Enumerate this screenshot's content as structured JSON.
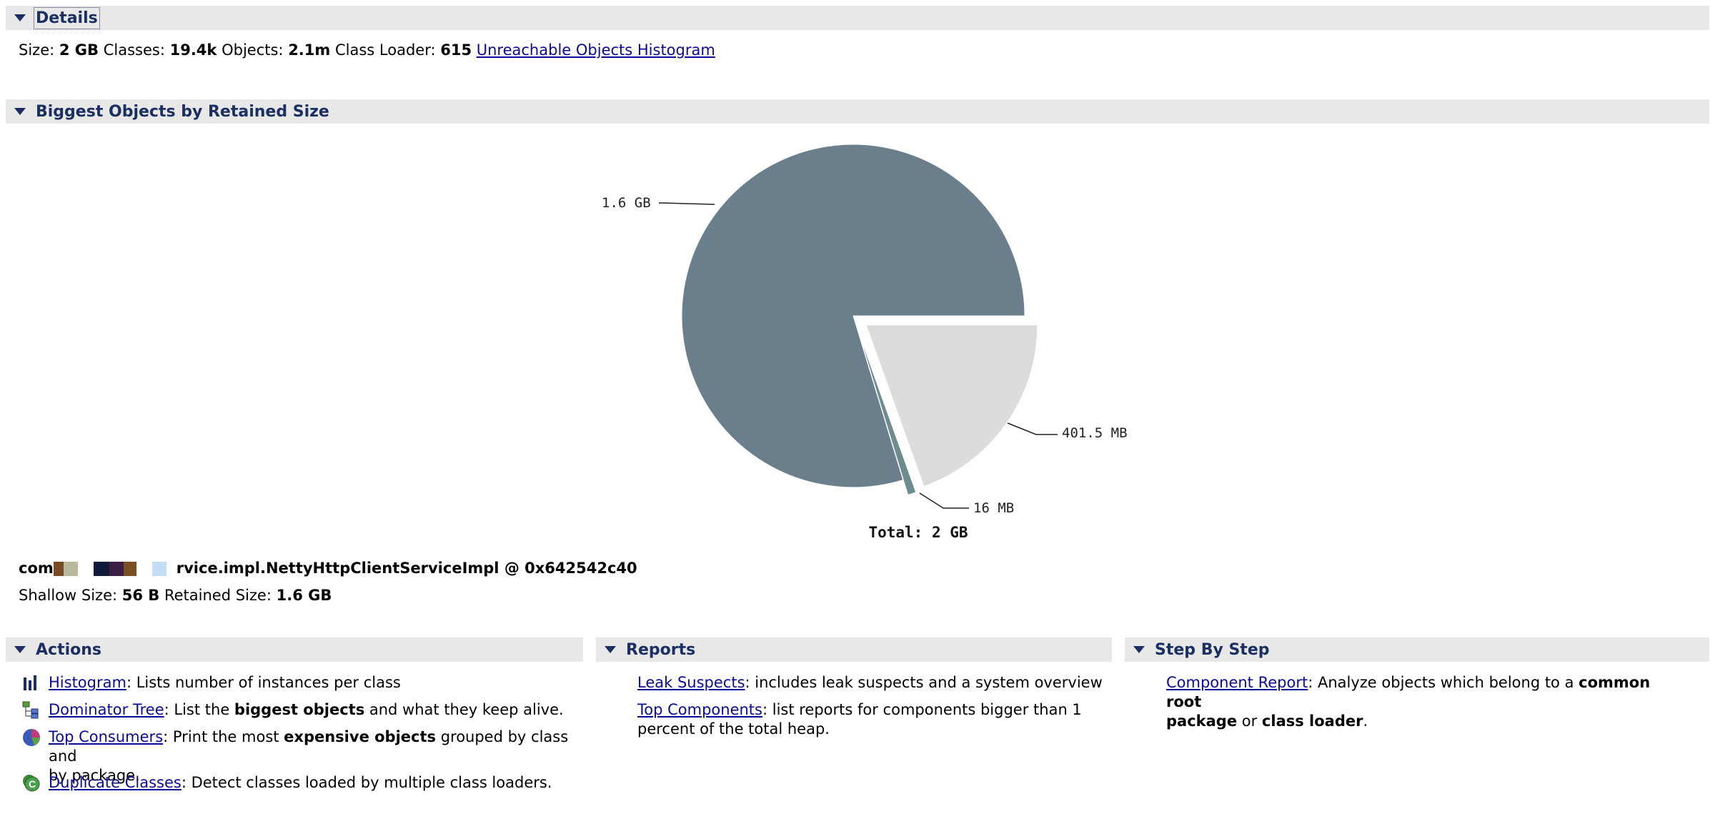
{
  "details": {
    "header": "Details",
    "size_label": "Size:",
    "size_value": "2 GB",
    "classes_label": "Classes:",
    "classes_value": "19.4k",
    "objects_label": "Objects:",
    "objects_value": "2.1m",
    "classloader_label": "Class Loader:",
    "classloader_value": "615",
    "unreachable_link": "Unreachable Objects Histogram"
  },
  "biggest": {
    "header": "Biggest Objects by Retained Size",
    "object_prefix": "com",
    "object_suffix": "rvice.impl.NettyHttpClientServiceImpl @ 0x642542c40",
    "shallow_label": "Shallow Size:",
    "shallow_value": "56 B",
    "retained_label": "Retained Size:",
    "retained_value": "1.6 GB"
  },
  "chart_data": {
    "type": "pie",
    "unit": "MB",
    "slices": [
      {
        "label": "1.6 GB",
        "value": 1638.4,
        "color": "#6a7f8b",
        "exploded": false
      },
      {
        "label": "16 MB",
        "value": 16,
        "color": "#6e8c90",
        "exploded": true
      },
      {
        "label": "401.5 MB",
        "value": 401.5,
        "color": "#dcdcdc",
        "exploded": true
      }
    ],
    "total_label": "Total: 2 GB"
  },
  "actions": {
    "header": "Actions",
    "items": [
      {
        "link": "Histogram",
        "text": ": Lists number of instances per class",
        "icon": "histogram-icon"
      },
      {
        "link": "Dominator Tree",
        "pre": ": List the ",
        "bold": "biggest objects",
        "post": " and what they keep alive.",
        "icon": "dominator-tree-icon"
      },
      {
        "link": "Top Consumers",
        "pre": ": Print the most ",
        "bold": "expensive objects",
        "post1": " grouped by class and",
        "post2": "by package.",
        "icon": "top-consumers-icon"
      },
      {
        "link": "Duplicate Classes",
        "text": ": Detect classes loaded by multiple class loaders.",
        "icon": "duplicate-classes-icon"
      }
    ]
  },
  "reports": {
    "header": "Reports",
    "items": [
      {
        "link": "Leak Suspects",
        "text": ": includes leak suspects and a system overview"
      },
      {
        "link": "Top Components",
        "text1": ": list reports for components bigger than 1",
        "text2": "percent of the total heap."
      }
    ]
  },
  "stepbystep": {
    "header": "Step By Step",
    "items": [
      {
        "link": "Component Report",
        "pre": ": Analyze objects which belong to a ",
        "bold1": "common root",
        "bold2": "package",
        "mid": " or ",
        "bold3": "class loader",
        "post": "."
      }
    ]
  },
  "colors": {
    "header_bg": "#e8e8e8",
    "header_text": "#1b2f63",
    "link": "#0b0b9a"
  }
}
